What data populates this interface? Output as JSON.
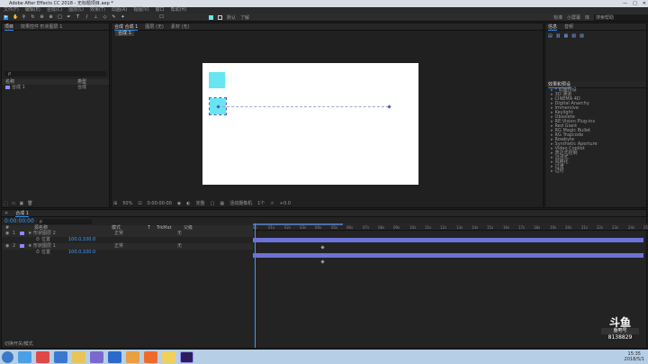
{
  "window": {
    "title": "Adobe After Effects CC 2018 - 无标题项目.aep *"
  },
  "menu": [
    "文件(F)",
    "编辑(E)",
    "合成(C)",
    "图层(L)",
    "效果(T)",
    "动画(A)",
    "视图(V)",
    "窗口",
    "帮助(H)"
  ],
  "toolbar": {
    "workspace_items": [
      "默认",
      "了解",
      "标准",
      "小屏幕",
      "库"
    ],
    "search_placeholder": "搜索帮助"
  },
  "project_panel": {
    "tabs": [
      "项目",
      "效果控件 形状图层 1"
    ],
    "search_placeholder": "ρ",
    "columns": [
      "名称",
      "类型"
    ],
    "items": [
      {
        "name": "合成 1",
        "type": "合成"
      }
    ]
  },
  "composition_panel": {
    "tabs": [
      "合成 合成 1",
      "图层 (无)",
      "素材 (无)"
    ],
    "breadcrumb": "合成 1",
    "footer": {
      "zoom": "50%",
      "timecode": "0:00:00:00",
      "resolution": "完整",
      "camera": "活动摄像机",
      "views": "1个",
      "offset": "+0.0"
    }
  },
  "right_panel": {
    "top_tabs": [
      "信息",
      "音频"
    ],
    "effects_title": "效果和预设",
    "effects": [
      "* 动画预设",
      "3D 通道",
      "CINEMA 4D",
      "Digital Anarchy",
      "Immersive",
      "Keylight",
      "Obsolete",
      "RE:Vision Plug-ins",
      "Red Giant",
      "RG Magic Bullet",
      "RG Trapcode",
      "Rowbyte",
      "Synthetic Aperture",
      "Video Copilot",
      "表达式控制",
      "沉浸式",
      "风格化",
      "过渡",
      "过时"
    ]
  },
  "timeline": {
    "tab": "合成 1",
    "timecode": "0:00:00:00",
    "search_placeholder": "ρ",
    "columns": [
      "#",
      "源名称",
      "模式",
      "T",
      "TrkMat",
      "父级"
    ],
    "layers": [
      {
        "num": "1",
        "name": "形状图层 2",
        "mode": "正常",
        "parent": "无",
        "prop": "位置",
        "value": "100.0,100.0"
      },
      {
        "num": "2",
        "name": "形状图层 1",
        "mode": "正常",
        "parent": "无",
        "prop": "位置",
        "value": "100.0,100.0"
      }
    ],
    "ruler": [
      "0s",
      "01s",
      "02s",
      "03s",
      "04s",
      "05s",
      "06s",
      "07s",
      "08s",
      "09s",
      "10s",
      "11s",
      "12s",
      "13s",
      "14s",
      "15s",
      "16s",
      "17s",
      "18s",
      "19s",
      "20s",
      "21s",
      "22s",
      "23s",
      "24s",
      "25s"
    ],
    "footer_label": "切换开关/模式"
  },
  "watermark": {
    "brand": "斗鱼",
    "sub": "鱼吧号",
    "id": "8138829"
  },
  "taskbar": {
    "time": "15:35",
    "date": "2018/5/1"
  },
  "colors": {
    "accent": "#2d8ceb",
    "shape": "#67e6f2",
    "layer_bar": "#6c72d8",
    "label": "#8b8bff"
  }
}
